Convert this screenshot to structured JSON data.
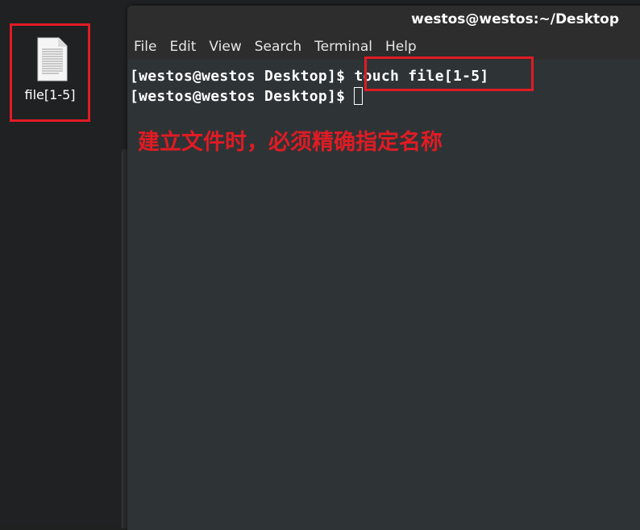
{
  "desktop": {
    "file_icon_label": "file[1-5]"
  },
  "terminal": {
    "title": "westos@westos:~/Desktop",
    "menu": [
      "File",
      "Edit",
      "View",
      "Search",
      "Terminal",
      "Help"
    ],
    "lines": [
      {
        "prompt": "[westos@westos Desktop]$ ",
        "command": "touch file[1-5]"
      },
      {
        "prompt": "[westos@westos Desktop]$ ",
        "command": ""
      }
    ],
    "annotation": "建立文件时，必须精确指定名称"
  },
  "colors": {
    "highlight": "#e01b24",
    "terminal_bg": "#2e3436",
    "titlebar_bg": "#2d2d2d"
  }
}
